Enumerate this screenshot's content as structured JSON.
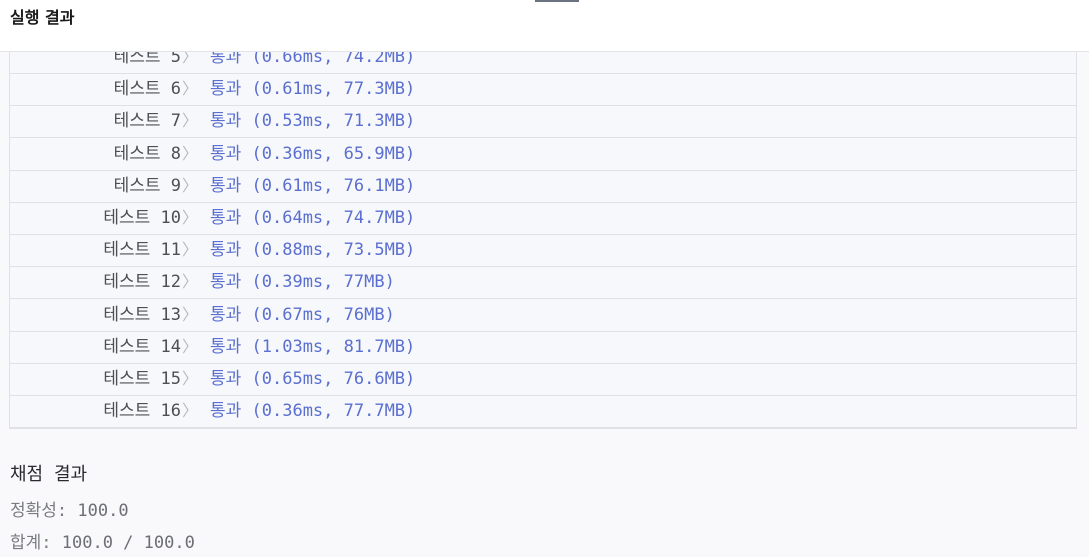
{
  "header": {
    "title": "실행 결과"
  },
  "results": [
    {
      "label": "테스트 5",
      "result": "통과 (0.66ms, 74.2MB)"
    },
    {
      "label": "테스트 6",
      "result": "통과 (0.61ms, 77.3MB)"
    },
    {
      "label": "테스트 7",
      "result": "통과 (0.53ms, 71.3MB)"
    },
    {
      "label": "테스트 8",
      "result": "통과 (0.36ms, 65.9MB)"
    },
    {
      "label": "테스트 9",
      "result": "통과 (0.61ms, 76.1MB)"
    },
    {
      "label": "테스트 10",
      "result": "통과 (0.64ms, 74.7MB)"
    },
    {
      "label": "테스트 11",
      "result": "통과 (0.88ms, 73.5MB)"
    },
    {
      "label": "테스트 12",
      "result": "통과 (0.39ms, 77MB)"
    },
    {
      "label": "테스트 13",
      "result": "통과 (0.67ms, 76MB)"
    },
    {
      "label": "테스트 14",
      "result": "통과 (1.03ms, 81.7MB)"
    },
    {
      "label": "테스트 15",
      "result": "통과 (0.65ms, 76.6MB)"
    },
    {
      "label": "테스트 16",
      "result": "통과 (0.36ms, 77.7MB)"
    }
  ],
  "chevron": "〉",
  "grading": {
    "title": "채점 결과",
    "accuracy_label": "정확성: ",
    "accuracy_value": "100.0",
    "total_label": "합계: ",
    "total_value": "100.0 / 100.0"
  },
  "colors": {
    "pass": "#5a6fcf",
    "label": "#4d4f55"
  }
}
